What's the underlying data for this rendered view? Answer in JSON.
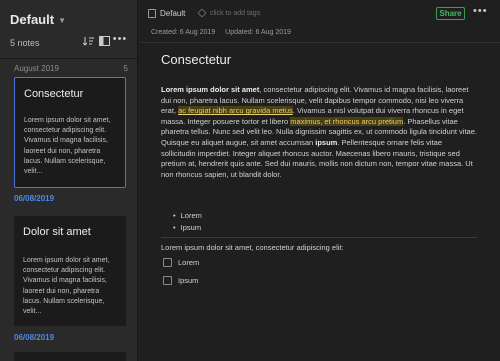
{
  "sidebar": {
    "notebook_title": "Default",
    "note_count": "5 notes",
    "month_label": "August 2019",
    "month_count": "5",
    "notes": [
      {
        "title": "Consectetur",
        "snippet": "Lorem ipsum dolor sit amet, consectetur adipiscing elit. Vivamus id magna facilisis, laoreet dui non, pharetra lacus. Nullam scelerisque, velit...",
        "date": "06/08/2019",
        "selected": true
      },
      {
        "title": "Dolor sit amet",
        "snippet": "Lorem ipsum dolor sit amet, consectetur adipiscing elit. Vivamus id magna facilisis, laoreet dui non, pharetra lacus. Nullam scelerisque, velit...",
        "date": "06/08/2019",
        "selected": false
      }
    ],
    "icons": [
      "sort-icon",
      "layout-icon",
      "more-icon",
      "chevron-down-icon"
    ]
  },
  "note": {
    "notebook_name": "Default",
    "tag_placeholder": "click to add tags",
    "share_label": "Share",
    "created": "Created: 6 Aug 2019",
    "updated": "Updated: 6 Aug 2019",
    "title": "Consectetur",
    "body": {
      "bold_lead": "Lorem ipsum dolor sit amet",
      "p1": ", consectetur adipiscing elit. Vivamus id magna facilisis, laoreet dui non, pharetra lacus. Nullam scelerisque, velit dapibus tempor commodo, nisi leo viverra erat, ",
      "hl1": "ac feugiat nibh arcu gravida metus",
      "p2": ". Vivamus a nisl volutpat dui viverra rhoncus in eget massa. Integer posuere tortor et libero ",
      "hl2": "maximus, et rhoncus arcu pretium",
      "p3": ". Phasellus vitae pharetra tellus. Nunc sed velit leo. Nulla dignissim sagittis ex, ut commodo ligula tincidunt vitae. Quisque eu aliquet augue, sit amet accumsan ",
      "bold2": "ipsum",
      "p4": ". Pellentesque ornare felis vitae sollicitudin imperdiet. Integer aliquet rhoncus auctor. Maecenas libero mauris, tristique sed pretium at, hendrerit quis ante. Sed dui mauris, mollis non dictum non, tempor vitae massa. Ut non rhoncus sapien, ut blandit dolor."
    },
    "bullets": [
      "Lorem",
      "Ipsum"
    ],
    "checklist_intro": "Lorem ipsum dolor sit amet, consectetur adipiscing elit:",
    "checklist": [
      "Lorem",
      "Ipsum"
    ]
  },
  "colors": {
    "accent_blue": "#4f88e6",
    "selection_border": "#4f73d6",
    "share_green": "#49b766",
    "highlight": "#e6cf6e"
  }
}
